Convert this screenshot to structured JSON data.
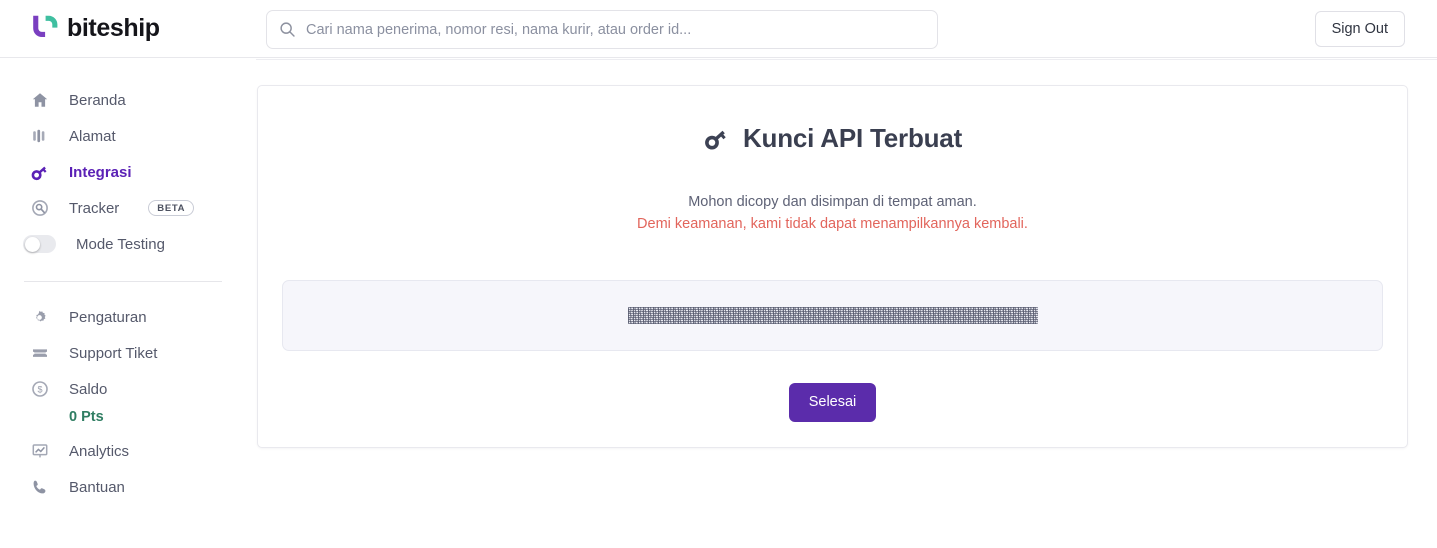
{
  "header": {
    "logo_text": "biteship",
    "logo_icon": "biteship-logo",
    "search": {
      "icon": "search-icon",
      "placeholder": "Cari nama penerima, nomor resi, nama kurir, atau order id...",
      "value": ""
    },
    "sign_out_label": "Sign Out"
  },
  "sidebar": {
    "items": [
      {
        "label": "Beranda",
        "icon": "home-icon",
        "active": false
      },
      {
        "label": "Alamat",
        "icon": "address-icon",
        "active": false
      },
      {
        "label": "Integrasi",
        "icon": "key-icon",
        "active": true
      },
      {
        "label": "Tracker",
        "icon": "tracker-icon",
        "active": false,
        "badge": "BETA"
      },
      {
        "label": "Mode Testing",
        "icon": "toggle-off",
        "active": false,
        "toggle": "off"
      }
    ],
    "items_secondary": [
      {
        "label": "Pengaturan",
        "icon": "gear-icon",
        "active": false
      },
      {
        "label": "Support Tiket",
        "icon": "ticket-icon",
        "active": false
      },
      {
        "label": "Saldo",
        "icon": "coin-icon",
        "active": false,
        "sub_value": "0 Pts"
      },
      {
        "label": "Analytics",
        "icon": "analytics-icon",
        "active": false
      },
      {
        "label": "Bantuan",
        "icon": "phone-icon",
        "active": false
      }
    ],
    "saldo_points": "0 Pts"
  },
  "main": {
    "title": "Kunci API Terbuat",
    "title_icon": "key-icon",
    "description_line_1": "Mohon dicopy dan disimpan di tempat aman.",
    "description_line_2": "Demi keamanan, kami tidak dapat menampilkannya kembali.",
    "api_key_value": "",
    "api_key_state": "redacted",
    "done_button_label": "Selesai"
  },
  "colors": {
    "brand_purple": "#5b21b6",
    "button_purple": "#5b2cab",
    "warning_red": "#e2655c",
    "points_green": "#2f7d62",
    "logo_teal": "#3fbfa0"
  }
}
